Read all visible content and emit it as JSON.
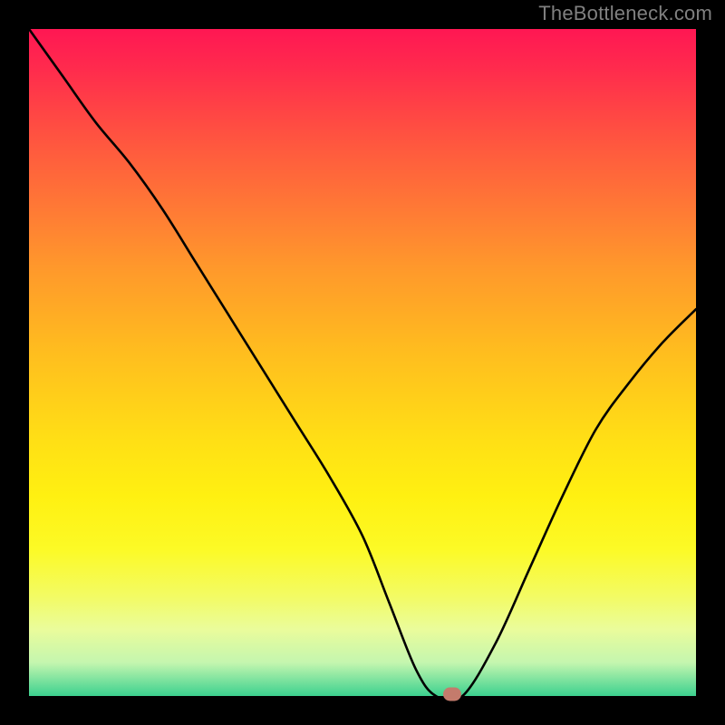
{
  "watermark": "TheBottleneck.com",
  "chart_data": {
    "type": "line",
    "title": "",
    "xlabel": "",
    "ylabel": "",
    "x_range": [
      0,
      100
    ],
    "y_range": [
      0,
      100
    ],
    "series": [
      {
        "name": "bottleneck-curve",
        "x": [
          0,
          5,
          10,
          15,
          20,
          25,
          30,
          35,
          40,
          45,
          50,
          54,
          58,
          61,
          65,
          70,
          75,
          80,
          85,
          90,
          95,
          100
        ],
        "values": [
          100,
          93,
          86,
          80,
          73,
          65,
          57,
          49,
          41,
          33,
          24,
          14,
          4,
          0,
          0,
          8,
          19,
          30,
          40,
          47,
          53,
          58
        ]
      }
    ],
    "marker": {
      "x": 63.5,
      "y": 0.3
    },
    "background_gradient": {
      "stops": [
        {
          "pos": 0,
          "color": "#ff1753"
        },
        {
          "pos": 50,
          "color": "#ffc81f"
        },
        {
          "pos": 80,
          "color": "#fdfb30"
        },
        {
          "pos": 100,
          "color": "#3cd18f"
        }
      ]
    }
  }
}
